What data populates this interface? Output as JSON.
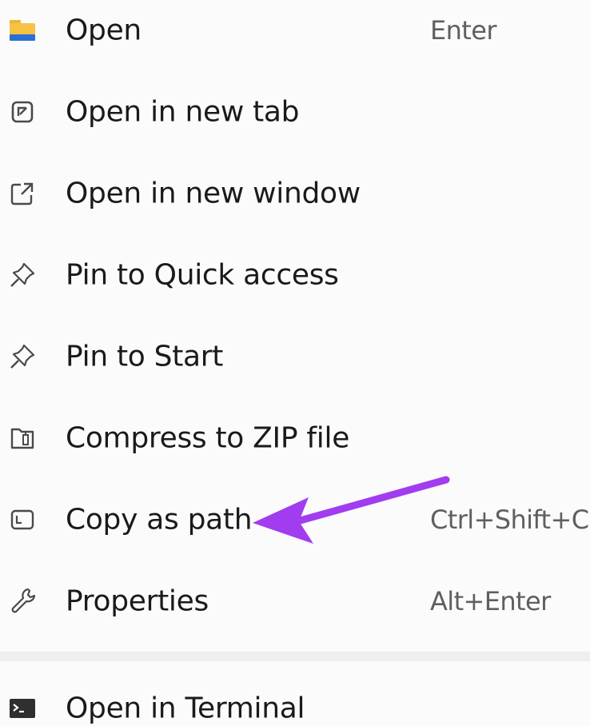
{
  "menu": {
    "items": [
      {
        "icon": "folder-icon",
        "label": "Open",
        "shortcut": "Enter"
      },
      {
        "icon": "new-tab-icon",
        "label": "Open in new tab",
        "shortcut": ""
      },
      {
        "icon": "new-window-icon",
        "label": "Open in new window",
        "shortcut": ""
      },
      {
        "icon": "pin-icon",
        "label": "Pin to Quick access",
        "shortcut": ""
      },
      {
        "icon": "pin-icon",
        "label": "Pin to Start",
        "shortcut": ""
      },
      {
        "icon": "zip-icon",
        "label": "Compress to ZIP file",
        "shortcut": ""
      },
      {
        "icon": "copy-path-icon",
        "label": "Copy as path",
        "shortcut": "Ctrl+Shift+C"
      },
      {
        "icon": "wrench-icon",
        "label": "Properties",
        "shortcut": "Alt+Enter"
      },
      {
        "icon": "terminal-icon",
        "label": "Open in Terminal",
        "shortcut": ""
      }
    ]
  },
  "colors": {
    "background": "#fbfbfb",
    "text": "#1a1a1a",
    "shortcut_text": "#5f5f5f",
    "folder_yellow": "#f5c242",
    "folder_blue": "#2a6fd6",
    "arrow_purple": "#a23cf0"
  },
  "annotation": {
    "type": "arrow",
    "color": "#a23cf0",
    "points_to": "Copy as path"
  }
}
